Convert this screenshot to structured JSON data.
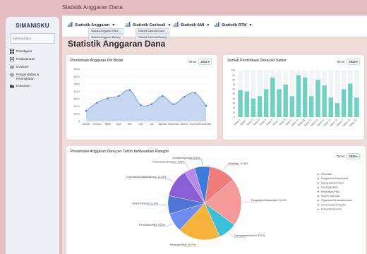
{
  "topbar": {
    "title": "Statistik Anggaran Dana"
  },
  "sidebar": {
    "brand": "SIMANISKU",
    "role": "Administrator",
    "items": [
      {
        "icon": "grid-icon",
        "label": "Penetapan"
      },
      {
        "icon": "document-icon",
        "label": "Pelaksanaan"
      },
      {
        "icon": "eye-icon",
        "label": "Evaluasi"
      },
      {
        "icon": "gear-icon",
        "label": "Pengendalian & Peningkatan"
      },
      {
        "icon": "folder-icon",
        "label": "Dokumen"
      }
    ]
  },
  "navbar": {
    "menus": [
      {
        "label": "Statistik Anggaran",
        "icon": "bar-chart-icon",
        "submenu": [
          "Statistik Anggaran Dana",
          "Statistik Anggaran Barang"
        ]
      },
      {
        "label": "Statistik Cashcall",
        "icon": "bar-chart-icon",
        "submenu": [
          "Statistik Cashcall Dana",
          "Statistik Cashcall Barang"
        ]
      },
      {
        "label": "Statistik AMI",
        "icon": "bar-chart-icon",
        "submenu": []
      },
      {
        "label": "Statistik RTM",
        "icon": "bar-chart-icon",
        "submenu": []
      }
    ]
  },
  "page": {
    "title": "Statistik Anggaran Dana"
  },
  "cards": {
    "line": {
      "title": "Permintaan Anggaran Per Bulan",
      "tahun_label": "Tahun:",
      "tahun_value": "2023"
    },
    "bar": {
      "title": "Jumlah Permintaan Dana per Satker",
      "tahun_label": "Tahun:",
      "tahun_value": "2023"
    },
    "pie": {
      "title": "Presentase Anggaran Dana per Tahun berdasarkan Kategori",
      "tahun_label": "Tahun:",
      "tahun_value": "2023"
    }
  },
  "chart_data": [
    {
      "type": "area",
      "title": "Permintaan Anggaran Per Bulan",
      "categories": [
        "Januari",
        "Februari",
        "Maret",
        "April",
        "Mei",
        "Juni",
        "Juli",
        "Agustus",
        "September",
        "Oktober",
        "November",
        "Desember"
      ],
      "values": [
        140,
        250,
        310,
        340,
        420,
        220,
        230,
        340,
        230,
        330,
        380,
        210
      ],
      "ylim": [
        0,
        700
      ],
      "yticks": [
        "0",
        "100,0",
        "200,0",
        "300,0",
        "400,0",
        "500,0",
        "600,0",
        "700,0"
      ],
      "color": "#7ea3dc",
      "fill": "#bdd0ef"
    },
    {
      "type": "bar",
      "title": "Jumlah Permintaan Dana per Satker",
      "categories": [
        "Satker 1",
        "Satker 2",
        "Satker 3",
        "Satker 4",
        "Satker 5",
        "Satker 6",
        "Satker 7",
        "Satker 8",
        "Satker 9",
        "Satker 10",
        "Satker 11",
        "Satker 12",
        "Satker 13",
        "Satker 14",
        "Satker 15",
        "Satker 16",
        "Satker 17",
        "Satker 18",
        "Satker 19"
      ],
      "values": [
        58,
        55,
        40,
        45,
        60,
        85,
        60,
        70,
        45,
        90,
        85,
        45,
        80,
        68,
        42,
        30,
        60,
        72,
        42
      ],
      "ylim": [
        0,
        100
      ],
      "yticks": [
        "0",
        "10",
        "20",
        "30",
        "40",
        "50",
        "60",
        "70",
        "80",
        "90",
        "100"
      ],
      "color": "#6fd1c0"
    },
    {
      "type": "pie",
      "title": "Presentase Anggaran Dana per Tahun berdasarkan Kategori",
      "slices": [
        {
          "label": "Penelitian",
          "value": 11.56,
          "color": "#ef7b7b"
        },
        {
          "label": "Pengabdian/Masyarakat",
          "value": 21.1,
          "color": "#f49a9a"
        },
        {
          "label": "Kepegawaian/Umum",
          "value": 8.2,
          "color": "#39c2d7"
        },
        {
          "label": "Keuangan/Aset",
          "value": 18.7,
          "color": "#f7b23b"
        },
        {
          "label": "Pendidikan/PBM",
          "value": 8.3,
          "color": "#6d8ef0"
        },
        {
          "label": "Sistem Informasi",
          "value": 8.1,
          "color": "#4f74d6"
        },
        {
          "label": "Organisasi/Ketatalaksanaan",
          "value": 12.4,
          "color": "#8a5ed6"
        },
        {
          "label": "Perencanaan/Program",
          "value": 4.8,
          "color": "#b68ae6"
        },
        {
          "label": "Humas/Kerjasama",
          "value": 6.84,
          "color": "#3b7bd9"
        }
      ],
      "legend": [
        "Penelitian",
        "Pengabdian/Masyarakat",
        "Kepegawaian/Umum",
        "Keuangan/Aset",
        "Pendidikan/PBM",
        "Sistem Informasi",
        "Organisasi/Ketatalaksanaan",
        "Perencanaan/Program",
        "Humas/Kerjasama"
      ],
      "legend_position": "right"
    }
  ]
}
